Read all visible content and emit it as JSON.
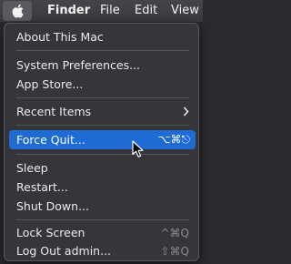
{
  "menubar": {
    "finder": "Finder",
    "file": "File",
    "edit": "Edit",
    "view": "View",
    "apple_icon": "apple-logo-icon"
  },
  "menu": {
    "about": "About This Mac",
    "system_preferences": "System Preferences...",
    "app_store": "App Store...",
    "recent_items": "Recent Items",
    "force_quit": "Force Quit...",
    "force_quit_shortcut": "⌥⌘⎋",
    "sleep": "Sleep",
    "restart": "Restart...",
    "shut_down": "Shut Down...",
    "lock_screen": "Lock Screen",
    "lock_screen_shortcut": "^⌘Q",
    "log_out": "Log Out admin...",
    "log_out_shortcut": "⇧⌘Q"
  },
  "colors": {
    "highlight": "#1f6bd6",
    "menu_bg": "#363539",
    "text": "#ebebeb",
    "shortcut_text": "#8c8b90"
  }
}
